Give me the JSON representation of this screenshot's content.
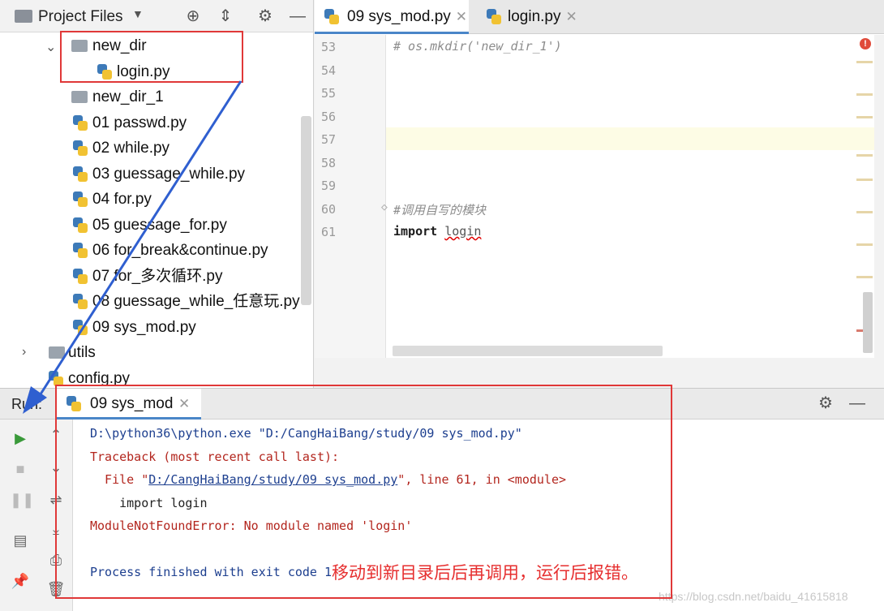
{
  "project": {
    "title": "Project Files",
    "tree": [
      {
        "label": "new_dir",
        "kind": "folder"
      },
      {
        "label": "login.py",
        "kind": "py"
      },
      {
        "label": "new_dir_1",
        "kind": "folder"
      },
      {
        "label": "01 passwd.py",
        "kind": "py"
      },
      {
        "label": "02 while.py",
        "kind": "py"
      },
      {
        "label": "03 guessage_while.py",
        "kind": "py"
      },
      {
        "label": "04 for.py",
        "kind": "py"
      },
      {
        "label": "05 guessage_for.py",
        "kind": "py"
      },
      {
        "label": "06 for_break&continue.py",
        "kind": "py"
      },
      {
        "label": "07 for_多次循环.py",
        "kind": "py"
      },
      {
        "label": "08 guessage_while_任意玩.py",
        "kind": "py"
      },
      {
        "label": "09 sys_mod.py",
        "kind": "py"
      },
      {
        "label": "utils",
        "kind": "folder"
      },
      {
        "label": "config.py",
        "kind": "py"
      }
    ]
  },
  "editor": {
    "tabs": [
      {
        "label": "09 sys_mod.py",
        "active": true
      },
      {
        "label": "login.py",
        "active": false
      }
    ],
    "line_numbers": [
      "53",
      "54",
      "55",
      "56",
      "57",
      "58",
      "59",
      "60",
      "61"
    ],
    "code": {
      "line53": "# os.mkdir('new_dir_1')",
      "line60": "#调用自写的模块",
      "line61_kw": "import",
      "line61_mod": "login"
    }
  },
  "run": {
    "label": "Run:",
    "tab": "09 sys_mod",
    "output": {
      "cmd": "D:\\python36\\python.exe \"D:/CangHaiBang/study/09 sys_mod.py\"",
      "traceback": "Traceback (most recent call last):",
      "file_prefix": "  File \"",
      "file_link": "D:/CangHaiBang/study/09 sys_mod.py",
      "file_suffix": "\", line 61, in <module>",
      "import_line": "    import login",
      "error": "ModuleNotFoundError: No module named 'login'",
      "finish": "Process finished with exit code 1"
    },
    "annotation": "移动到新目录后后再调用，运行后报错。",
    "watermark": "https://blog.csdn.net/baidu_41615818"
  },
  "colors": {
    "accent": "#4a86c8",
    "annotation_red": "#e62e2e",
    "arrow_blue": "#2f5fd0"
  }
}
